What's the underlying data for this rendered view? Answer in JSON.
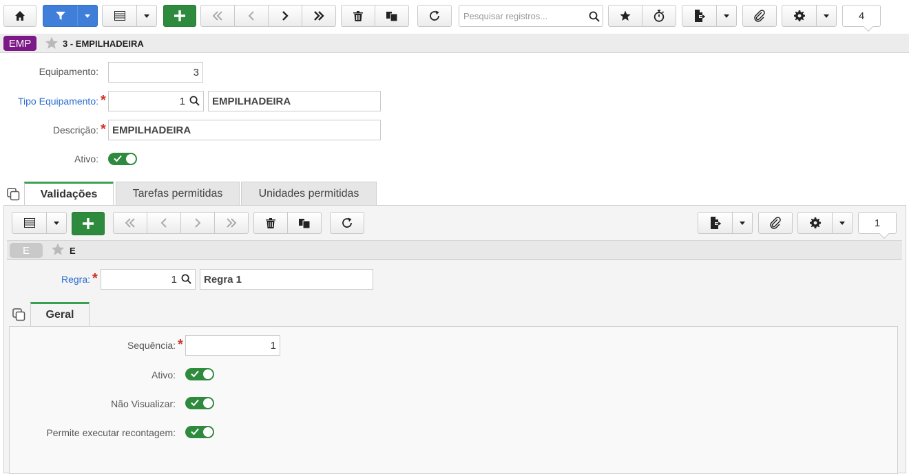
{
  "toolbar": {
    "search_placeholder": "Pesquisar registros...",
    "record_count": "4"
  },
  "header": {
    "badge": "EMP",
    "badge_color": "#7b1a86",
    "title": "3 - EMPILHADEIRA"
  },
  "form": {
    "equipamento_label": "Equipamento:",
    "equipamento_value": "3",
    "tipo_label": "Tipo Equipamento:",
    "tipo_code": "1",
    "tipo_desc": "EMPILHADEIRA",
    "descricao_label": "Descrição:",
    "descricao_value": "EMPILHADEIRA",
    "ativo_label": "Ativo:",
    "ativo_on": true
  },
  "tabs": [
    {
      "label": "Validações",
      "active": true
    },
    {
      "label": "Tarefas permitidas",
      "active": false
    },
    {
      "label": "Unidades permitidas",
      "active": false
    }
  ],
  "sub_toolbar": {
    "record_count": "1"
  },
  "sub_header": {
    "badge": "E",
    "title": "E"
  },
  "sub_form": {
    "regra_label": "Regra:",
    "regra_code": "1",
    "regra_desc": "Regra 1"
  },
  "inner_tab": {
    "label": "Geral"
  },
  "geral": {
    "sequencia_label": "Sequência:",
    "sequencia_value": "1",
    "ativo_label": "Ativo:",
    "nao_visualizar_label": "Não Visualizar:",
    "recontagem_label": "Permite executar recontagem:"
  },
  "colors": {
    "green": "#2e8b3e",
    "blue": "#3f7fd9",
    "link": "#2a6dd0",
    "required": "#d0342c"
  }
}
